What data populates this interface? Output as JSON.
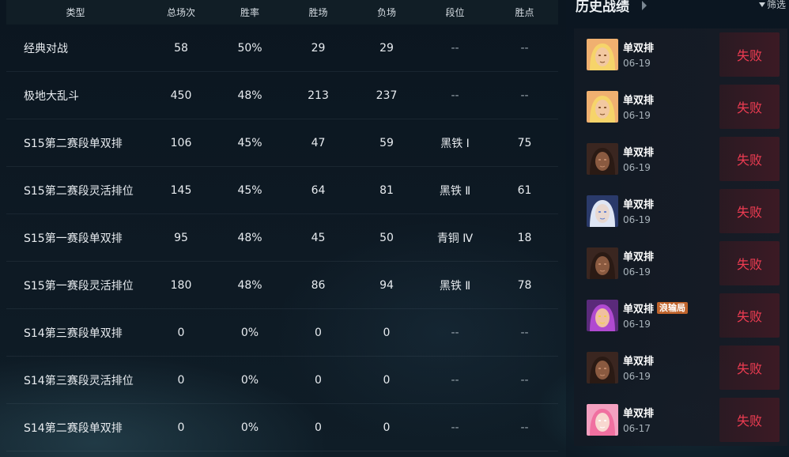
{
  "table": {
    "headers": {
      "type": "类型",
      "total": "总场次",
      "rate": "胜率",
      "wins": "胜场",
      "losses": "负场",
      "rank": "段位",
      "points": "胜点"
    },
    "rows": [
      {
        "type": "经典对战",
        "total": "58",
        "rate": "50%",
        "wins": "29",
        "losses": "29",
        "rank": "--",
        "points": "--"
      },
      {
        "type": "极地大乱斗",
        "total": "450",
        "rate": "48%",
        "wins": "213",
        "losses": "237",
        "rank": "--",
        "points": "--"
      },
      {
        "type": "S15第二赛段单双排",
        "total": "106",
        "rate": "45%",
        "wins": "47",
        "losses": "59",
        "rank": "黑铁 Ⅰ",
        "points": "75"
      },
      {
        "type": "S15第二赛段灵活排位",
        "total": "145",
        "rate": "45%",
        "wins": "64",
        "losses": "81",
        "rank": "黑铁 Ⅱ",
        "points": "61"
      },
      {
        "type": "S15第一赛段单双排",
        "total": "95",
        "rate": "48%",
        "wins": "45",
        "losses": "50",
        "rank": "青铜 Ⅳ",
        "points": "18"
      },
      {
        "type": "S15第一赛段灵活排位",
        "total": "180",
        "rate": "48%",
        "wins": "86",
        "losses": "94",
        "rank": "黑铁 Ⅱ",
        "points": "78"
      },
      {
        "type": "S14第三赛段单双排",
        "total": "0",
        "rate": "0%",
        "wins": "0",
        "losses": "0",
        "rank": "--",
        "points": "--"
      },
      {
        "type": "S14第三赛段灵活排位",
        "total": "0",
        "rate": "0%",
        "wins": "0",
        "losses": "0",
        "rank": "--",
        "points": "--"
      },
      {
        "type": "S14第二赛段单双排",
        "total": "0",
        "rate": "0%",
        "wins": "0",
        "losses": "0",
        "rank": "--",
        "points": "--"
      }
    ]
  },
  "history": {
    "title": "历史战绩",
    "filter_label": "筛选",
    "matches": [
      {
        "mode": "单双排",
        "badge": "",
        "date": "06-19",
        "result": "失败",
        "avatar": "champion-portrait-blonde"
      },
      {
        "mode": "单双排",
        "badge": "",
        "date": "06-19",
        "result": "失败",
        "avatar": "champion-portrait-blonde"
      },
      {
        "mode": "单双排",
        "badge": "",
        "date": "06-19",
        "result": "失败",
        "avatar": "champion-portrait-dark"
      },
      {
        "mode": "单双排",
        "badge": "",
        "date": "06-19",
        "result": "失败",
        "avatar": "champion-portrait-blue"
      },
      {
        "mode": "单双排",
        "badge": "",
        "date": "06-19",
        "result": "失败",
        "avatar": "champion-portrait-dark"
      },
      {
        "mode": "单双排",
        "badge": "浪输局",
        "date": "06-19",
        "result": "失败",
        "avatar": "champion-portrait-purple"
      },
      {
        "mode": "单双排",
        "badge": "",
        "date": "06-19",
        "result": "失败",
        "avatar": "champion-portrait-dark"
      },
      {
        "mode": "单双排",
        "badge": "",
        "date": "06-17",
        "result": "失败",
        "avatar": "champion-portrait-pink"
      }
    ]
  },
  "colors": {
    "loss": "#ee3c52",
    "badge": "#c0642c",
    "background": "#0d1620"
  }
}
